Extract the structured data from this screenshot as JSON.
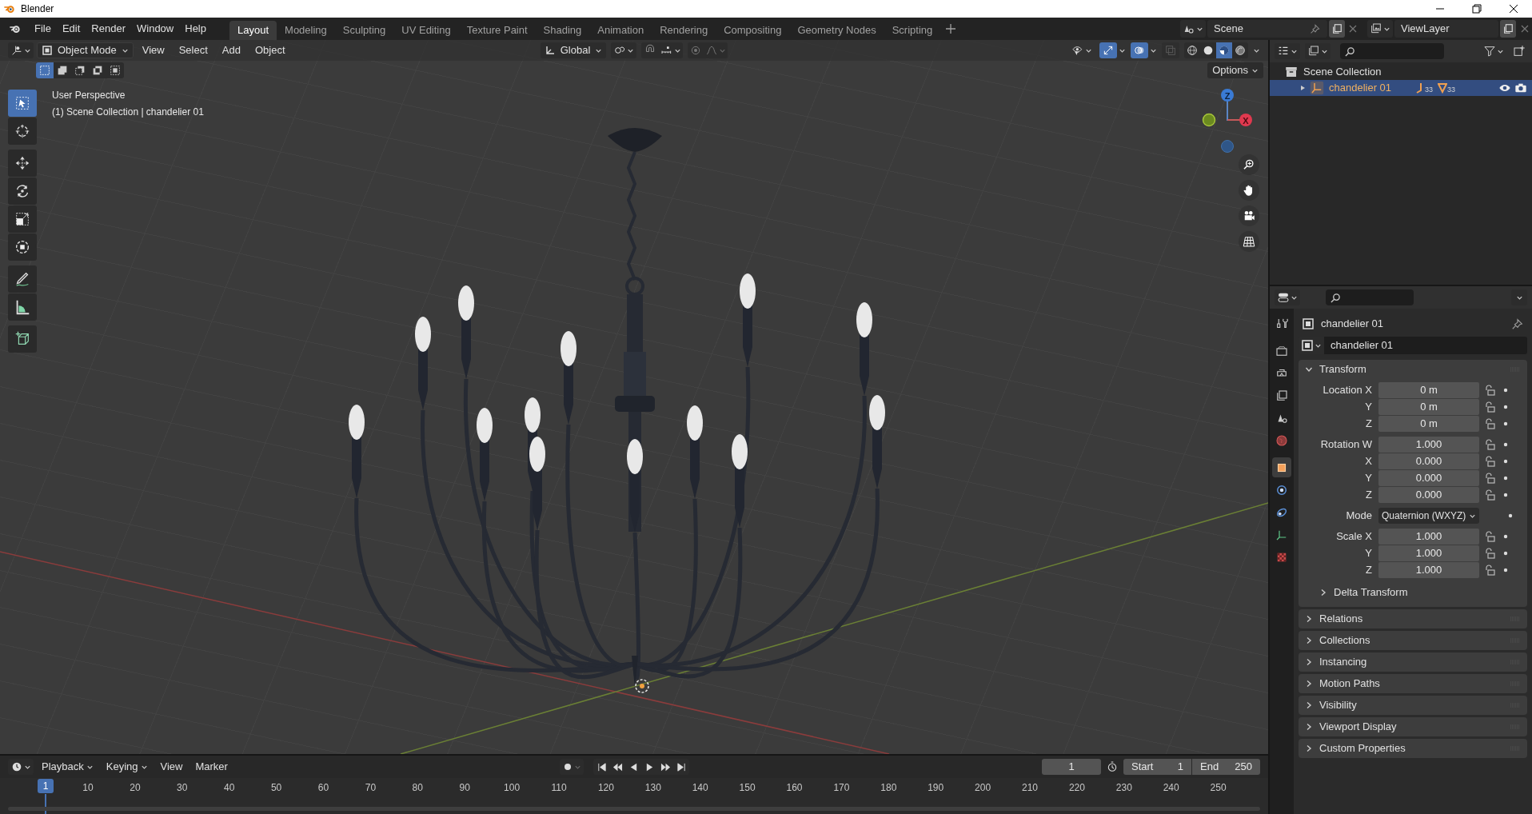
{
  "window": {
    "title": "Blender"
  },
  "menu": [
    "File",
    "Edit",
    "Render",
    "Window",
    "Help"
  ],
  "workspaces": [
    {
      "label": "Layout",
      "selected": true
    },
    {
      "label": "Modeling",
      "selected": false
    },
    {
      "label": "Sculpting",
      "selected": false
    },
    {
      "label": "UV Editing",
      "selected": false
    },
    {
      "label": "Texture Paint",
      "selected": false
    },
    {
      "label": "Shading",
      "selected": false
    },
    {
      "label": "Animation",
      "selected": false
    },
    {
      "label": "Rendering",
      "selected": false
    },
    {
      "label": "Compositing",
      "selected": false
    },
    {
      "label": "Geometry Nodes",
      "selected": false
    },
    {
      "label": "Scripting",
      "selected": false
    }
  ],
  "scene": {
    "name": "Scene"
  },
  "view_layer": {
    "name": "ViewLayer"
  },
  "viewport": {
    "mode": "Object Mode",
    "menus": [
      "View",
      "Select",
      "Add",
      "Object"
    ],
    "orientation": "Global",
    "select_modes": [
      {
        "kind": "new",
        "selected": true
      },
      {
        "kind": "extend",
        "selected": false
      },
      {
        "kind": "subtract",
        "selected": false
      },
      {
        "kind": "invert",
        "selected": false
      },
      {
        "kind": "intersect",
        "selected": false
      }
    ],
    "toggles": [
      {
        "kind": "gizmo",
        "on": true
      },
      {
        "kind": "overlay",
        "on": true
      },
      {
        "kind": "xray",
        "on": false
      }
    ],
    "shading": [
      {
        "kind": "wireframe",
        "selected": false
      },
      {
        "kind": "solid",
        "selected": false
      },
      {
        "kind": "material",
        "selected": true
      },
      {
        "kind": "rendered",
        "selected": false
      }
    ],
    "options": "Options",
    "info": [
      "User Perspective",
      "(1) Scene Collection | chandelier 01"
    ],
    "tools": [
      {
        "kind": "select",
        "selected": true
      },
      {
        "kind": "cursor",
        "selected": false
      },
      {
        "kind": "move",
        "selected": false
      },
      {
        "kind": "rotate",
        "selected": false
      },
      {
        "kind": "scale",
        "selected": false
      },
      {
        "kind": "transform",
        "selected": false
      },
      {
        "kind": "annotate",
        "selected": false
      },
      {
        "kind": "measure",
        "selected": false
      },
      {
        "kind": "add_cube",
        "selected": false
      }
    ],
    "gizmo": {
      "z": "Z",
      "x": "X"
    }
  },
  "outliner": {
    "items": [
      {
        "label": "Scene Collection",
        "children": [
          {
            "label": "chandelier 01",
            "selected": true,
            "expanded": false,
            "badges": [
              "33",
              "33"
            ]
          }
        ]
      }
    ]
  },
  "properties": {
    "tabs": [
      {
        "kind": "tool",
        "selected": false
      },
      {
        "kind": "render",
        "selected": false
      },
      {
        "kind": "output",
        "selected": false
      },
      {
        "kind": "view_layer",
        "selected": false
      },
      {
        "kind": "scene",
        "selected": false
      },
      {
        "kind": "world",
        "selected": false
      },
      {
        "kind": "object",
        "selected": true
      },
      {
        "kind": "physics",
        "selected": false
      },
      {
        "kind": "constraints",
        "selected": false
      },
      {
        "kind": "data",
        "selected": false
      },
      {
        "kind": "texture",
        "selected": false
      }
    ],
    "object": "chandelier 01",
    "data_name": "chandelier 01",
    "panels": [
      {
        "label": "Transform",
        "expanded": true,
        "groups": [
          [
            {
              "kind": "number",
              "label": "Location X",
              "value": "0 m"
            },
            {
              "kind": "number",
              "label": "Y",
              "value": "0 m"
            },
            {
              "kind": "number",
              "label": "Z",
              "value": "0 m"
            }
          ],
          [
            {
              "kind": "number",
              "label": "Rotation W",
              "value": "1.000"
            },
            {
              "kind": "number",
              "label": "X",
              "value": "0.000"
            },
            {
              "kind": "number",
              "label": "Y",
              "value": "0.000"
            },
            {
              "kind": "number",
              "label": "Z",
              "value": "0.000"
            }
          ],
          [
            {
              "kind": "dropdown",
              "label": "Mode",
              "value": "Quaternion (WXYZ)"
            }
          ],
          [
            {
              "kind": "number",
              "label": "Scale X",
              "value": "1.000"
            },
            {
              "kind": "number",
              "label": "Y",
              "value": "1.000"
            },
            {
              "kind": "number",
              "label": "Z",
              "value": "1.000"
            }
          ]
        ],
        "subpanels": [
          {
            "label": "Delta Transform",
            "expanded": false
          }
        ]
      },
      {
        "label": "Relations",
        "expanded": false
      },
      {
        "label": "Collections",
        "expanded": false
      },
      {
        "label": "Instancing",
        "expanded": false
      },
      {
        "label": "Motion Paths",
        "expanded": false
      },
      {
        "label": "Visibility",
        "expanded": false
      },
      {
        "label": "Viewport Display",
        "expanded": false
      },
      {
        "label": "Custom Properties",
        "expanded": false
      }
    ]
  },
  "timeline": {
    "menus": [
      {
        "kind": "dropdown",
        "label": "Playback"
      },
      {
        "kind": "dropdown",
        "label": "Keying"
      },
      {
        "kind": "menu",
        "label": "View"
      },
      {
        "kind": "menu",
        "label": "Marker"
      }
    ],
    "current_frame": "1",
    "start": {
      "label": "Start",
      "value": "1"
    },
    "end": {
      "label": "End",
      "value": "250"
    },
    "playhead": "1",
    "ruler": [
      "10",
      "20",
      "30",
      "40",
      "50",
      "60",
      "70",
      "80",
      "90",
      "100",
      "110",
      "120",
      "130",
      "140",
      "150",
      "160",
      "170",
      "180",
      "190",
      "200",
      "210",
      "220",
      "230",
      "240",
      "250"
    ]
  }
}
